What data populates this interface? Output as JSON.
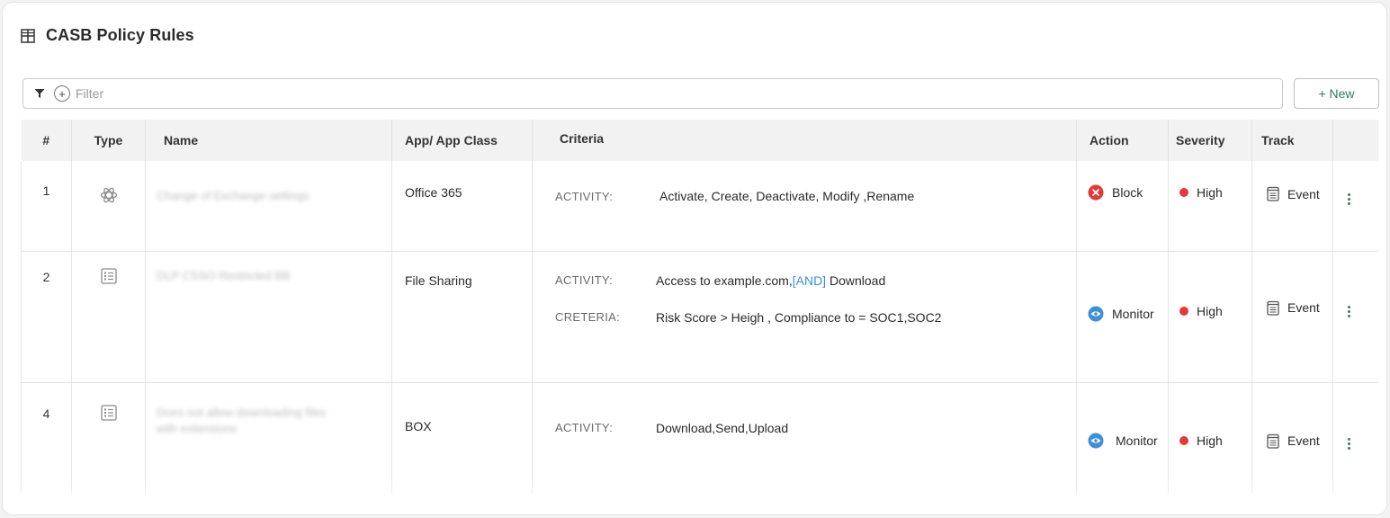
{
  "header": {
    "title": "CASB Policy Rules",
    "icon": "grid-table-icon"
  },
  "filter": {
    "placeholder": "Filter",
    "icons": [
      "funnel-icon",
      "plus-circle-icon"
    ]
  },
  "toolbar": {
    "new_label": "+ New"
  },
  "table": {
    "columns": [
      "#",
      "Type",
      "Name",
      "App/ App Class",
      "Criteria",
      "Action",
      "Severity",
      "Track",
      ""
    ],
    "rows": [
      {
        "num": "1",
        "type_icon": "atom-icon",
        "name_lines": [
          "Change of Exchange settings"
        ],
        "app": "Office 365",
        "criteria": [
          {
            "key": "ACTIVITY:",
            "value": "Activate, Create, Deactivate, Modify ,Rename"
          }
        ],
        "action": "Block",
        "action_icon": "block-x-circle-icon",
        "severity": "High",
        "track": "Event"
      },
      {
        "num": "2",
        "type_icon": "list-document-icon",
        "name_lines": [
          "DLP CSSO Restricted BB"
        ],
        "app": "File  Sharing",
        "criteria": [
          {
            "key": "ACTIVITY:",
            "value_pre": "Access   to example.com,",
            "value_and": "[AND]",
            "value_post": " Download"
          },
          {
            "key": "CRETERIA:",
            "value": "Risk Score > Heigh , Compliance to  = SOC1,SOC2"
          }
        ],
        "action": "Monitor",
        "action_icon": "eye-circle-icon",
        "severity": "High",
        "track": "Event"
      },
      {
        "num": "4",
        "type_icon": "list-document-icon",
        "name_lines": [
          "Does not allow downloading files",
          "with extensions"
        ],
        "app": "BOX",
        "criteria": [
          {
            "key": "ACTIVITY:",
            "value": "Download,Send,Upload"
          }
        ],
        "action": "Monitor",
        "action_icon": "eye-circle-icon",
        "severity": "High",
        "track": "Event"
      }
    ]
  },
  "colors": {
    "block": "#e53935",
    "monitor": "#3f8fd8",
    "severity_high": "#e53935",
    "accent_green": "#2e7d5b",
    "and_link": "#3b8fd9"
  }
}
